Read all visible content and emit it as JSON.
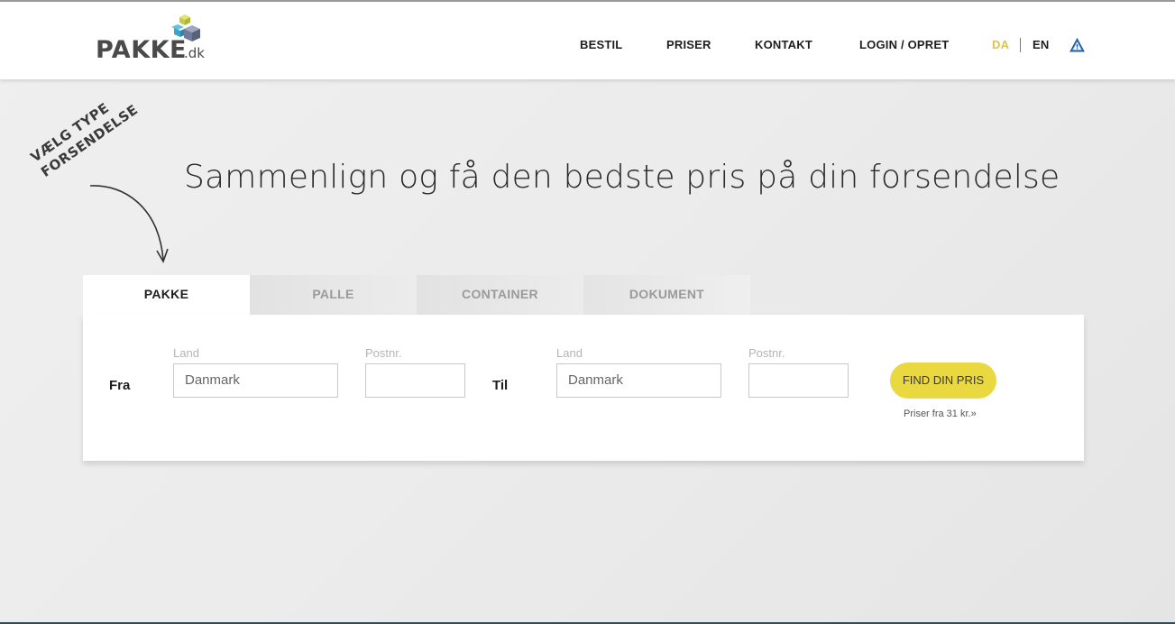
{
  "header": {
    "logo_text": "PAKKE",
    "logo_suffix": ".dk",
    "nav": {
      "bestil": "BESTIL",
      "priser": "PRISER",
      "kontakt": "KONTAKT",
      "login": "LOGIN / OPRET"
    },
    "languages": {
      "da": "DA",
      "en": "EN"
    },
    "warning_icon": "warning-triangle-icon"
  },
  "note": {
    "line1": "VÆLG TYPE",
    "line2": "FORSENDELSE"
  },
  "headline": "Sammenlign og få den bedste pris på din forsendelse",
  "tabs": [
    "PAKKE",
    "PALLE",
    "CONTAINER",
    "DOKUMENT"
  ],
  "form": {
    "from_label": "Fra",
    "to_label": "Til",
    "country_label": "Land",
    "postcode_label": "Postnr.",
    "from_country": "Danmark",
    "to_country": "Danmark",
    "from_postcode": "",
    "to_postcode": "",
    "submit_label": "FIND DIN PRIS",
    "price_note": "Priser fra 31 kr.»"
  },
  "colors": {
    "accent_yellow": "#ead841",
    "lang_active": "#e5c33b",
    "warning_blue": "#3a7fd0"
  }
}
